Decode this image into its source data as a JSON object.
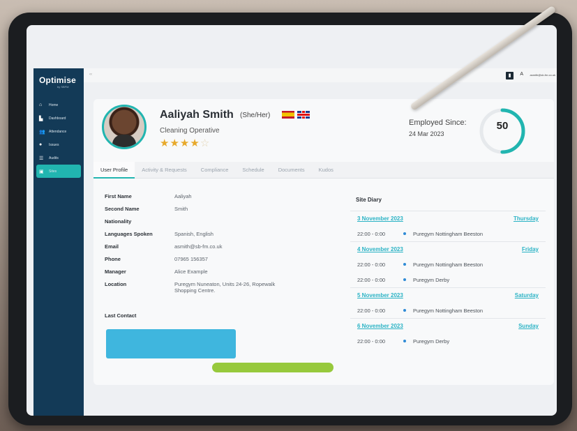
{
  "app": {
    "logo": "Optimise",
    "logo_sub": "by SBFM"
  },
  "sidebar": {
    "items": [
      {
        "label": "Home",
        "icon": "home-icon"
      },
      {
        "label": "Dashboard",
        "icon": "chart-icon"
      },
      {
        "label": "Attendance",
        "icon": "users-icon"
      },
      {
        "label": "Issues",
        "icon": "alert-icon"
      },
      {
        "label": "Audits",
        "icon": "list-icon"
      },
      {
        "label": "Sites",
        "icon": "building-icon"
      }
    ]
  },
  "topbar": {
    "user_initial": "A",
    "email": "asmith@sb-fm.co.uk"
  },
  "profile": {
    "name": "Aaliyah Smith",
    "pronouns": "(She/Her)",
    "role": "Cleaning Operative",
    "rating": 4,
    "rating_max": 5,
    "employed_label": "Employed Since:",
    "employed_date": "24 Mar 2023",
    "score": "50",
    "score_fraction": 0.5,
    "flags": [
      "spain-flag",
      "uk-flag"
    ]
  },
  "tabs": [
    "User Profile",
    "Activity & Requests",
    "Compliance",
    "Schedule",
    "Documents",
    "Kudos"
  ],
  "fields": [
    {
      "label": "First Name",
      "value": "Aaliyah"
    },
    {
      "label": "Second Name",
      "value": "Smith"
    },
    {
      "label": "Nationality",
      "value": ""
    },
    {
      "label": "Languages Spoken",
      "value": "Spanish, English"
    },
    {
      "label": "Email",
      "value": "asmith@sb-fm.co.uk"
    },
    {
      "label": "Phone",
      "value": "07965 156357"
    },
    {
      "label": "Manager",
      "value": "Alice Example"
    },
    {
      "label": "Location",
      "value": "Puregym Nuneaton, Units 24-26, Ropewalk Shopping Centre."
    }
  ],
  "last_contact_label": "Last Contact",
  "diary": {
    "title": "Site Diary",
    "days": [
      {
        "date": "3 November 2023",
        "day": "Thursday",
        "shifts": [
          {
            "time": "22:00 - 0:00",
            "site": "Puregym Nottingham Beeston"
          }
        ]
      },
      {
        "date": "4 November 2023",
        "day": "Friday",
        "shifts": [
          {
            "time": "22:00 - 0:00",
            "site": "Puregym Nottingham Beeston"
          },
          {
            "time": "22:00 - 0:00",
            "site": "Puregym Derby"
          }
        ]
      },
      {
        "date": "5 November 2023",
        "day": "Saturday",
        "shifts": [
          {
            "time": "22:00 - 0:00",
            "site": "Puregym Nottingham Beeston"
          }
        ]
      },
      {
        "date": "6 November 2023",
        "day": "Sunday",
        "shifts": [
          {
            "time": "22:00 - 0:00",
            "site": "Puregym Derby"
          }
        ]
      }
    ]
  },
  "colors": {
    "sidebar": "#133a57",
    "accent": "#21b5b0",
    "star": "#e7a92b",
    "link": "#2bb3c5"
  }
}
